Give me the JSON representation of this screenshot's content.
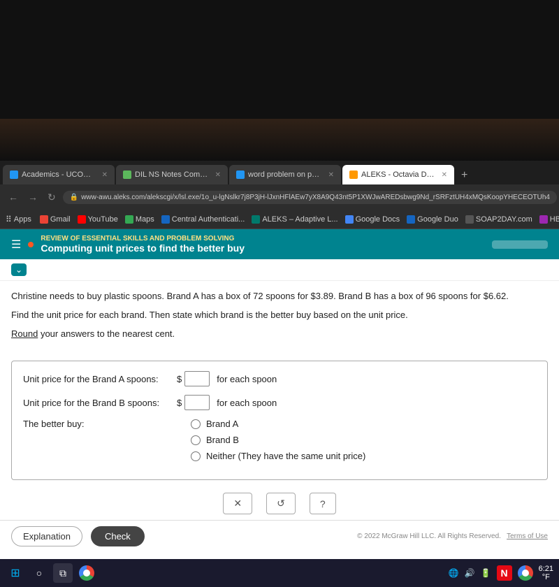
{
  "browser": {
    "tabs": [
      {
        "id": "academics",
        "label": "Academics - UCONNECT@UCO",
        "active": false,
        "faviconClass": "blue2"
      },
      {
        "id": "ns-notes",
        "label": "DIL NS Notes Complete · Quantitat",
        "active": false,
        "faviconClass": "green"
      },
      {
        "id": "word-problem",
        "label": "word problem on proportions ·",
        "active": false,
        "faviconClass": "blue2"
      },
      {
        "id": "aleks",
        "label": "ALEKS - Octavia Davis - Learn",
        "active": true,
        "faviconClass": "orange"
      }
    ],
    "tab_new_label": "+",
    "url": "www-awu.aleks.com/alekscgi/x/lsl.exe/1o_u-lgNslkr7j8P3jH-lJxnHFlAEw7yX8A9Q43nt5P1XWJwAREDsbwg9Nd_rSRFztUH4xMQsKoopYHECEOTUh4",
    "bookmarks": [
      {
        "id": "apps",
        "label": "Apps",
        "faviconClass": ""
      },
      {
        "id": "gmail",
        "label": "Gmail",
        "faviconClass": "gmail"
      },
      {
        "id": "youtube",
        "label": "YouTube",
        "faviconClass": "youtube"
      },
      {
        "id": "maps",
        "label": "Maps",
        "faviconClass": "maps"
      },
      {
        "id": "central",
        "label": "Central Authenticati...",
        "faviconClass": "central"
      },
      {
        "id": "aleks-adaptive",
        "label": "ALEKS – Adaptive L...",
        "faviconClass": "aleks"
      },
      {
        "id": "gdocs",
        "label": "Google Docs",
        "faviconClass": "gdocs"
      },
      {
        "id": "gduo",
        "label": "Google Duo",
        "faviconClass": "gduo"
      },
      {
        "id": "soap",
        "label": "SOAP2DAY.com",
        "faviconClass": "soap"
      },
      {
        "id": "hbo",
        "label": "HBO Max",
        "faviconClass": "hbo"
      }
    ]
  },
  "aleks": {
    "header_small": "REVIEW OF ESSENTIAL SKILLS AND PROBLEM SOLVING",
    "header_title": "Computing unit prices to find the better buy",
    "problem_text": "Christine needs to buy plastic spoons. Brand A has a box of 72 spoons for $3.89. Brand B has a box of 96 spoons for $6.62.",
    "find_text": "Find the unit price for each brand. Then state which brand is the better buy based on the unit price.",
    "round_text": "Round your answers to the nearest cent.",
    "round_underline": "Round",
    "field_brand_a_label": "Unit price for the Brand A spoons:",
    "field_brand_b_label": "Unit price for the Brand B spoons:",
    "for_each_spoon_a": "for each spoon",
    "for_each_spoon_b": "for each spoon",
    "better_buy_label": "The better buy:",
    "radio_options": [
      {
        "id": "brand-a",
        "label": "Brand A"
      },
      {
        "id": "brand-b",
        "label": "Brand B"
      },
      {
        "id": "neither",
        "label": "Neither (They have the same unit price)"
      }
    ],
    "action_buttons": {
      "cancel": "✕",
      "undo": "↺",
      "help": "?"
    },
    "explanation_btn": "Explanation",
    "check_btn": "Check",
    "copyright": "© 2022 McGraw Hill LLC. All Rights Reserved.",
    "terms": "Terms of Use"
  },
  "taskbar": {
    "time": "6:21°F"
  }
}
